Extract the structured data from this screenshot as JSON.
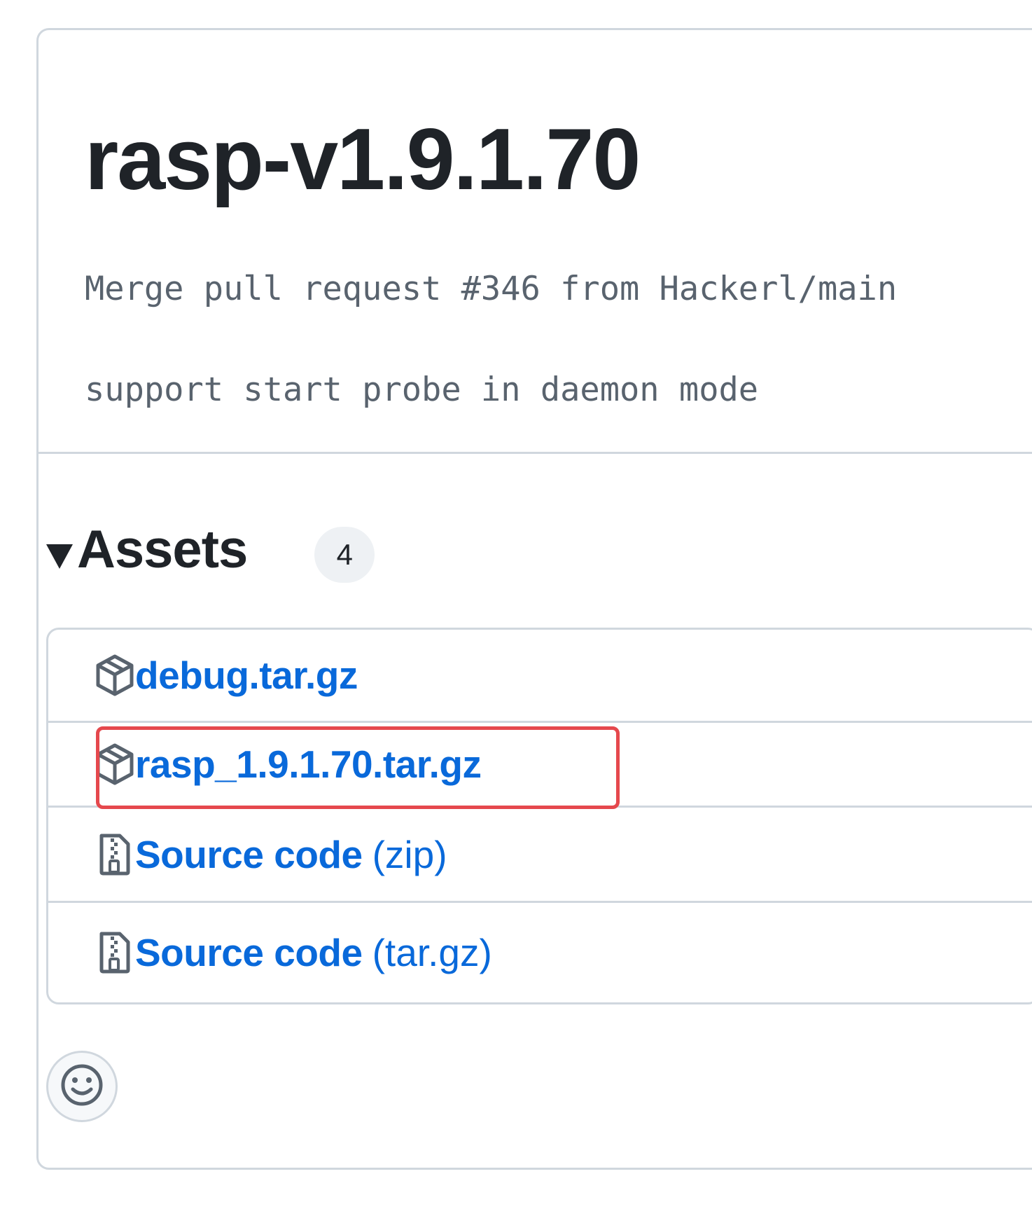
{
  "release": {
    "title": "rasp-v1.9.1.70",
    "body_lines": [
      "Merge pull request #346 from Hackerl/main",
      "support start probe in daemon mode"
    ]
  },
  "assets": {
    "title": "Assets",
    "count": "4",
    "items": [
      {
        "name": "debug.tar.gz",
        "format": "",
        "icon": "package-icon"
      },
      {
        "name": "rasp_1.9.1.70.tar.gz",
        "format": "",
        "icon": "package-icon",
        "highlighted": true
      },
      {
        "name": "Source code",
        "format": "(zip)",
        "icon": "file-zip-icon"
      },
      {
        "name": "Source code",
        "format": "(tar.gz)",
        "icon": "file-zip-icon"
      }
    ]
  },
  "reaction": {
    "icon": "smiley-icon"
  },
  "colors": {
    "link": "#0969da",
    "text": "#1f2328",
    "muted": "#59636e",
    "border": "#d0d7de",
    "highlight": "#e5484d",
    "counter_bg": "#eef1f4"
  }
}
